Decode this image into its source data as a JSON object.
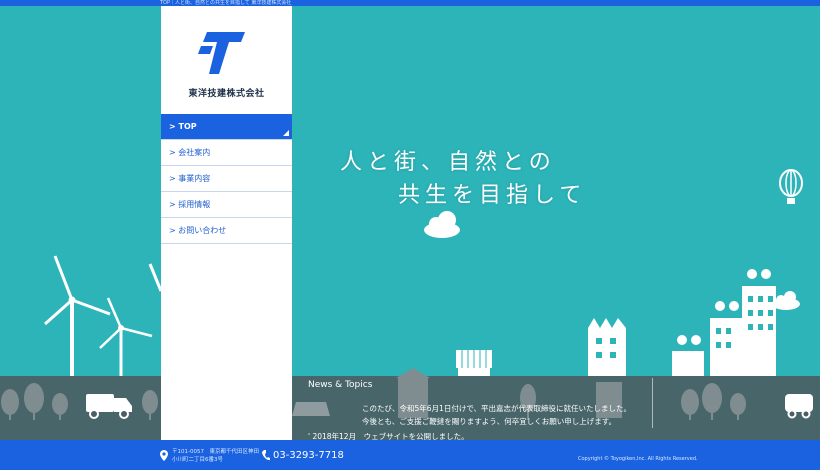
{
  "topbar": {
    "text": "TOP｜人と街、自然との共生を目指して 東洋技建株式会社"
  },
  "brand": {
    "company_name": "東洋技建株式会社",
    "accent": "#1a62e0",
    "hero_bg": "#2cb4b9"
  },
  "nav": {
    "items": [
      {
        "label": "> TOP",
        "active": true
      },
      {
        "label": "> 会社案内"
      },
      {
        "label": "> 事業内容"
      },
      {
        "label": "> 採用情報"
      },
      {
        "label": "> お問い合わせ"
      }
    ]
  },
  "hero": {
    "line1": "人と街、自然との",
    "line2": "共生を目指して"
  },
  "news": {
    "title": "News & Topics",
    "body1": "このたび、令和5年6月1日付けで、平出嘉志が代表取締役に就任いたしました。",
    "body2": "今後とも、ご支援ご鞭撻を賜りますよう、何卒宜しくお願い申し上げます。",
    "item2": "' 2018年12月　ウェブサイトを公開しました。"
  },
  "footer": {
    "address_line1": "〒101-0057　東京都千代田区神田",
    "address_line2": "小川町二丁目6番3号",
    "phone": "03-3293-7718",
    "copyright": "Copyright © Toyogiken,Inc. All Rights Reserved."
  },
  "icons": [
    "logo-icon",
    "location-pin-icon",
    "phone-icon",
    "balloon-icon",
    "cloud-icon",
    "wind-turbine-icon",
    "solar-panel-icon",
    "truck-icon",
    "ev-charger-icon",
    "building-icon",
    "tree-icon"
  ]
}
